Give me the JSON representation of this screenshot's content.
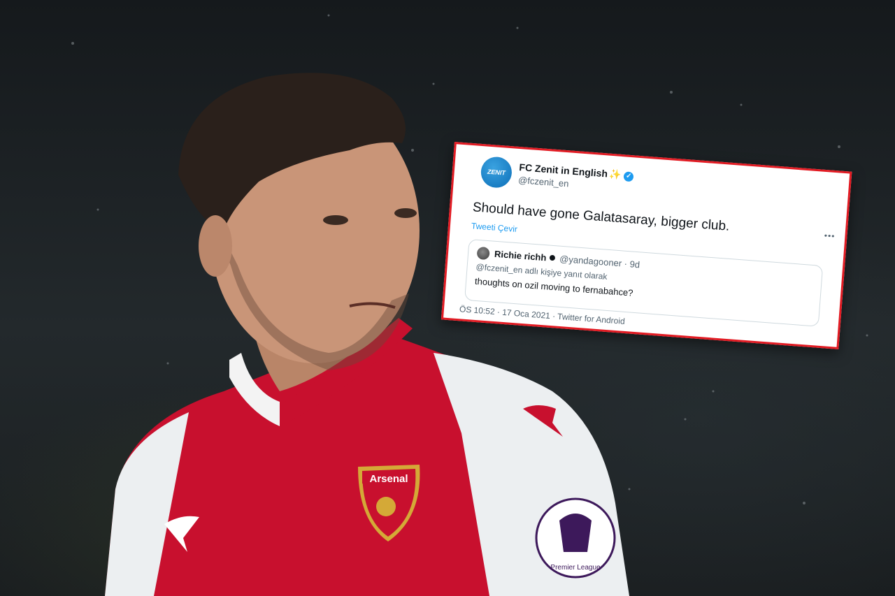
{
  "tweet": {
    "author_name": "FC Zenit in English",
    "author_emoji": "✨",
    "author_handle": "@fczenit_en",
    "text": "Should have gone Galatasaray, bigger club.",
    "translate_label": "Tweeti Çevir",
    "more_icon": "•••",
    "timestamp": "ÖS 10:52 · 17 Oca 2021 · Twitter for Android",
    "quoted": {
      "author_name": "Richie richh",
      "author_handle": "@yandagooner · 9d",
      "reply_context": "@fczenit_en adlı kişiye yanıt olarak",
      "text": "thoughts on ozil moving to fernabahce?"
    }
  },
  "jersey": {
    "badge_text": "Arsenal",
    "sleeve_patch_text": "Premier League"
  },
  "colors": {
    "frame_red": "#e21b23",
    "twitter_blue": "#1d9bf0",
    "shirt_red": "#c8102e"
  }
}
